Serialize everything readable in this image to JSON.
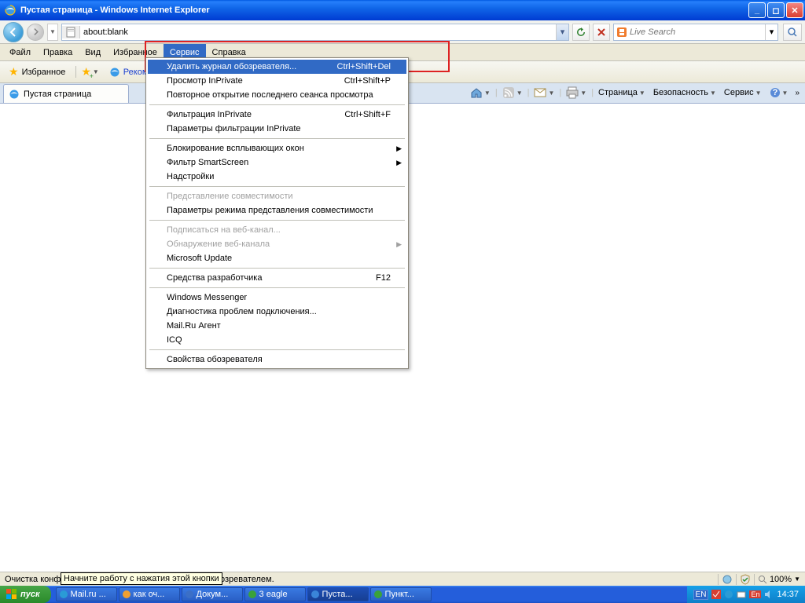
{
  "title": "Пустая страница - Windows Internet Explorer",
  "url": "about:blank",
  "search_placeholder": "Live Search",
  "menubar": [
    "Файл",
    "Правка",
    "Вид",
    "Избранное",
    "Сервис",
    "Справка"
  ],
  "favbar": {
    "favorites": "Избранное",
    "recommended": "Рекомендуе..."
  },
  "tab": {
    "title": "Пустая страница"
  },
  "cmdbar": {
    "page": "Страница",
    "safety": "Безопасность",
    "service": "Сервис"
  },
  "dropdown": {
    "items": [
      {
        "label": "Удалить журнал обозревателя...",
        "shortcut": "Ctrl+Shift+Del",
        "hl": true
      },
      {
        "label": "Просмотр InPrivate",
        "shortcut": "Ctrl+Shift+P"
      },
      {
        "label": "Повторное открытие последнего сеанса просмотра"
      },
      {
        "sep": true
      },
      {
        "label": "Фильтрация InPrivate",
        "shortcut": "Ctrl+Shift+F"
      },
      {
        "label": "Параметры фильтрации InPrivate"
      },
      {
        "sep": true
      },
      {
        "label": "Блокирование всплывающих окон",
        "sub": true
      },
      {
        "label": "Фильтр SmartScreen",
        "sub": true
      },
      {
        "label": "Надстройки"
      },
      {
        "sep": true
      },
      {
        "label": "Представление совместимости",
        "disabled": true
      },
      {
        "label": "Параметры режима представления совместимости"
      },
      {
        "sep": true
      },
      {
        "label": "Подписаться на веб-канал...",
        "disabled": true
      },
      {
        "label": "Обнаружение веб-канала",
        "sub": true,
        "disabled": true
      },
      {
        "label": "Microsoft Update"
      },
      {
        "sep": true
      },
      {
        "label": "Средства разработчика",
        "shortcut": "F12"
      },
      {
        "sep": true
      },
      {
        "label": "Windows Messenger"
      },
      {
        "label": "Диагностика проблем подключения..."
      },
      {
        "label": "Mail.Ru Агент"
      },
      {
        "label": "ICQ"
      },
      {
        "sep": true
      },
      {
        "label": "Свойства обозревателя"
      }
    ]
  },
  "status": {
    "left1": "Очистка конфи",
    "left2": "обозревателем.",
    "tooltip": "Начните работу с нажатия этой кнопки",
    "zoom": "100%"
  },
  "taskbar": {
    "start": "пуск",
    "tasks": [
      {
        "label": "Mail.ru ...",
        "color": "#2a9bd6"
      },
      {
        "label": "как оч...",
        "color": "#f0a030"
      },
      {
        "label": "Докум...",
        "color": "#3b6fc7"
      },
      {
        "label": "3 eagle",
        "color": "#3aa23a"
      },
      {
        "label": "Пуста...",
        "color": "#3a85d8",
        "active": true
      },
      {
        "label": "Пункт...",
        "color": "#3aa23a"
      }
    ],
    "lang": "EN",
    "time": "14:37"
  }
}
